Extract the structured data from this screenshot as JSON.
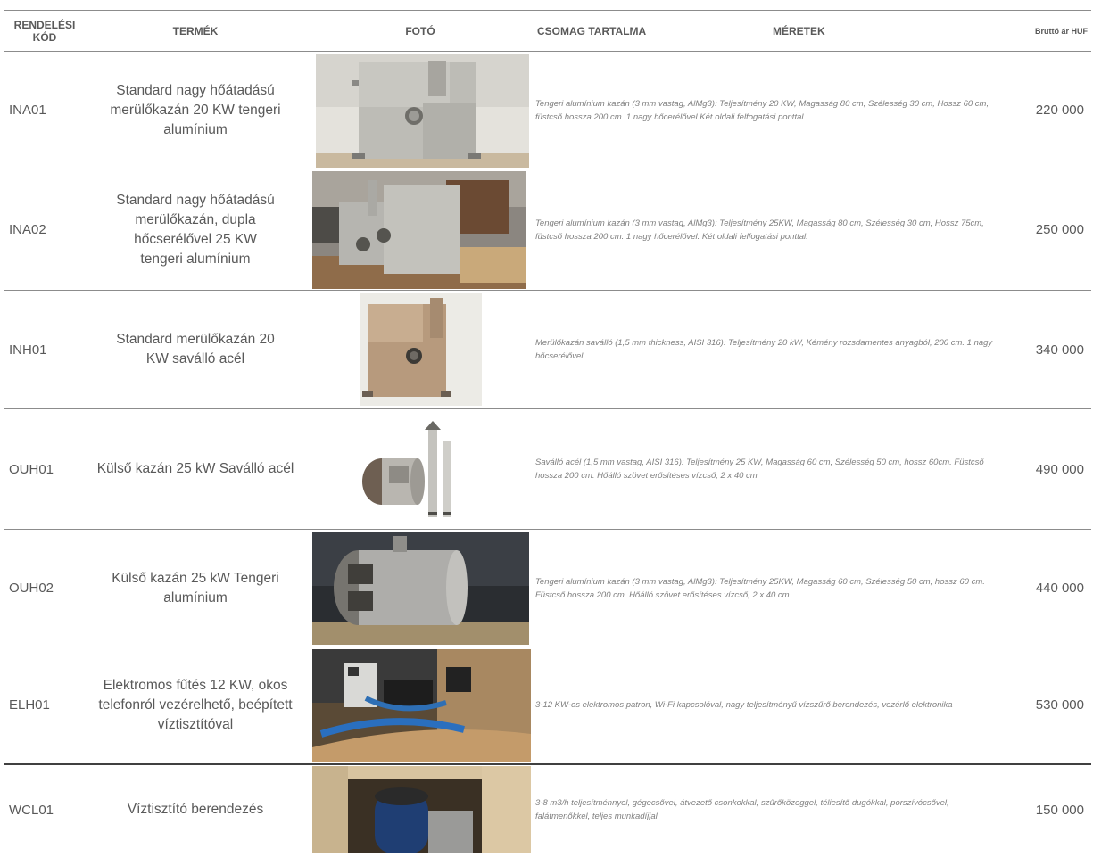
{
  "headers": {
    "code": "RENDELÉSI KÓD",
    "product": "TERMÉK",
    "photo": "FOTÓ",
    "package": "CSOMAG TARTALMA",
    "dimensions": "MÉRETEK",
    "price": "Bruttó ár HUF"
  },
  "rows": [
    {
      "code": "INA01",
      "name": "Standard nagy hőátadású merülőkazán 20 KW tengeri alumínium",
      "photo_icon": "aluminium-immersion-boiler-photo",
      "description": "Tengeri alumínium kazán (3 mm vastag, AlMg3): Teljesítmény 20 KW, Magasság 80 cm, Szélesség 30 cm, Hossz 60 cm, füstcső hossza 200 cm. 1 nagy hőcerélővel.Két oldali felfogatási ponttal.",
      "price": "220 000"
    },
    {
      "code": "INA02",
      "name": "Standard nagy hőátadású merülőkazán, dupla hőcserélővel 25 KW tengeri alumínium",
      "photo_icon": "double-exchanger-boiler-photo",
      "description": "Tengeri alumínium kazán (3 mm vastag, AlMg3): Teljesítmény 25KW, Magasság 80 cm, Szélesség 30 cm, Hossz 75cm, füstcső hossza 200 cm. 1 nagy hőcerélővel. Két oldali felfogatási ponttal.",
      "price": "250 000"
    },
    {
      "code": "INH01",
      "name": "Standard merülőkazán 20 KW saválló acél",
      "photo_icon": "stainless-immersion-boiler-photo",
      "description": "Merülőkazán saválló (1,5 mm thickness, AISI 316): Teljesítmény 20 kW, Kémény rozsdamentes anyagból, 200 cm. 1 nagy hőcserélővel.",
      "price": "340 000"
    },
    {
      "code": "OUH01",
      "name": "Külső kazán 25 kW     Saválló acél",
      "photo_icon": "external-stainless-boiler-photo",
      "description": "Saválló acél (1,5 mm vastag, AISI 316): Teljesítmény 25 KW, Magasság 60 cm, Szélesség 50 cm, hossz 60cm. Füstcső hossza 200 cm. Hőálló szövet erősítéses vízcső, 2 x 40 cm",
      "price": "490 000"
    },
    {
      "code": "OUH02",
      "name": "Külső kazán 25 kW     Tengeri alumínium",
      "photo_icon": "external-aluminium-boiler-photo",
      "description": "Tengeri alumínium kazán (3 mm vastag, AlMg3): Teljesítmény 25KW, Magasság 60 cm, Szélesség 50 cm, hossz 60 cm. Füstcső hossza 200 cm. Hőálló szövet erősítéses vízcső, 2 x 40 cm",
      "price": "440 000"
    },
    {
      "code": "ELH01",
      "name": "Elektromos fűtés 12 KW, okos telefonról vezérelhető, beépített víztisztítóval",
      "photo_icon": "electric-heater-photo",
      "description": "3-12 KW-os elektromos patron, Wi-Fi kapcsolóval, nagy teljesítményű vízszűrő berendezés, vezérlő elektronika",
      "price": "530 000"
    },
    {
      "code": "WCL01",
      "name": "Víztisztító berendezés",
      "photo_icon": "water-cleaner-photo",
      "description": "3-8 m3/h teljesítménnyel, gégecsővel, átvezető csonkokkal, szűrőközeggel, téliesítő dugókkal, porszívócsővel, falátmenőkkel, teljes munkadíjjal",
      "price": "150 000"
    }
  ],
  "colors": {
    "text": "#595959",
    "description": "#7f7f7f",
    "rule": "#8c8c8c"
  }
}
